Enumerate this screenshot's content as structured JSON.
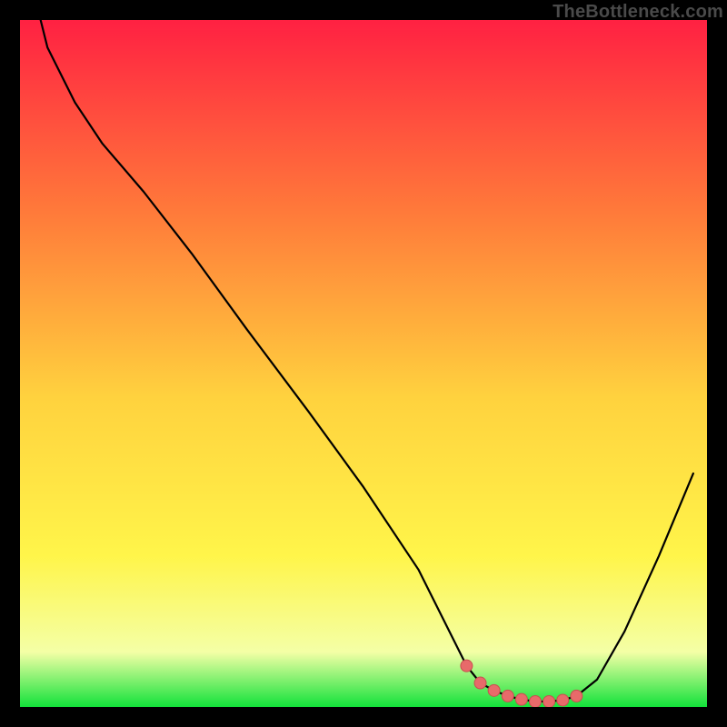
{
  "watermark": "TheBottleneck.com",
  "colors": {
    "background": "#000000",
    "gradient_top": "#ff2142",
    "gradient_mid_upper": "#ff7a3a",
    "gradient_mid": "#ffd23e",
    "gradient_mid_lower": "#fff54a",
    "gradient_lower": "#f4ffa6",
    "gradient_bottom": "#12e23a",
    "curve": "#000000",
    "marker_fill": "#e86a6a",
    "marker_stroke": "#c94f4f"
  },
  "chart_data": {
    "type": "line",
    "title": "",
    "xlabel": "",
    "ylabel": "",
    "xlim": [
      0,
      100
    ],
    "ylim": [
      0,
      100
    ],
    "series": [
      {
        "name": "bottleneck-curve",
        "x": [
          3,
          4,
          6,
          8,
          12,
          18,
          25,
          33,
          42,
          50,
          58,
          63,
          65,
          67,
          69,
          71,
          73,
          75,
          77,
          79,
          81,
          84,
          88,
          93,
          98
        ],
        "values": [
          100,
          96,
          92,
          88,
          82,
          75,
          66,
          55,
          43,
          32,
          20,
          10,
          6,
          3.5,
          2.4,
          1.6,
          1.1,
          0.8,
          0.8,
          1.0,
          1.6,
          4,
          11,
          22,
          34
        ]
      }
    ],
    "markers": {
      "name": "optimal-range-markers",
      "x": [
        65,
        67,
        69,
        71,
        73,
        75,
        77,
        79,
        81
      ],
      "values": [
        6,
        3.5,
        2.4,
        1.6,
        1.1,
        0.8,
        0.8,
        1.0,
        1.6
      ]
    }
  }
}
